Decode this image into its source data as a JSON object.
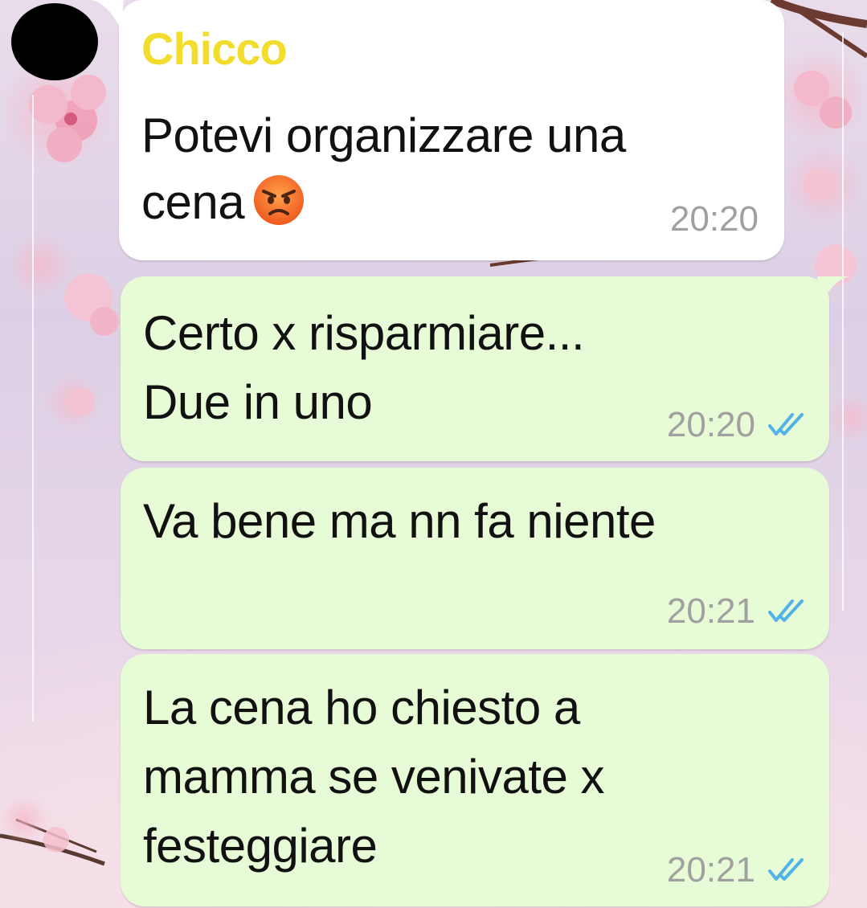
{
  "chat": {
    "messages": [
      {
        "direction": "incoming",
        "sender": "Chicco",
        "lines": [
          "Potevi organizzare una",
          "cena"
        ],
        "emoji": "angry-face-emoji",
        "time": "20:20"
      },
      {
        "direction": "outgoing",
        "lines": [
          "Certo x risparmiare...",
          "Due in uno"
        ],
        "time": "20:20",
        "status": "read-double-check"
      },
      {
        "direction": "outgoing",
        "lines": [
          "Va bene ma nn fa niente"
        ],
        "time": "20:21",
        "status": "read-double-check"
      },
      {
        "direction": "outgoing",
        "lines": [
          "La cena ho chiesto a",
          "mamma se venivate x",
          "festeggiare"
        ],
        "time": "20:21",
        "status": "read-double-check"
      }
    ]
  },
  "colors": {
    "incoming_bubble": "#ffffff",
    "outgoing_bubble": "#e7fbd6",
    "sender_name": "#f2dc2c",
    "timestamp": "#a0a0a0",
    "read_ticks": "#4fb3e8",
    "text": "#111111"
  }
}
